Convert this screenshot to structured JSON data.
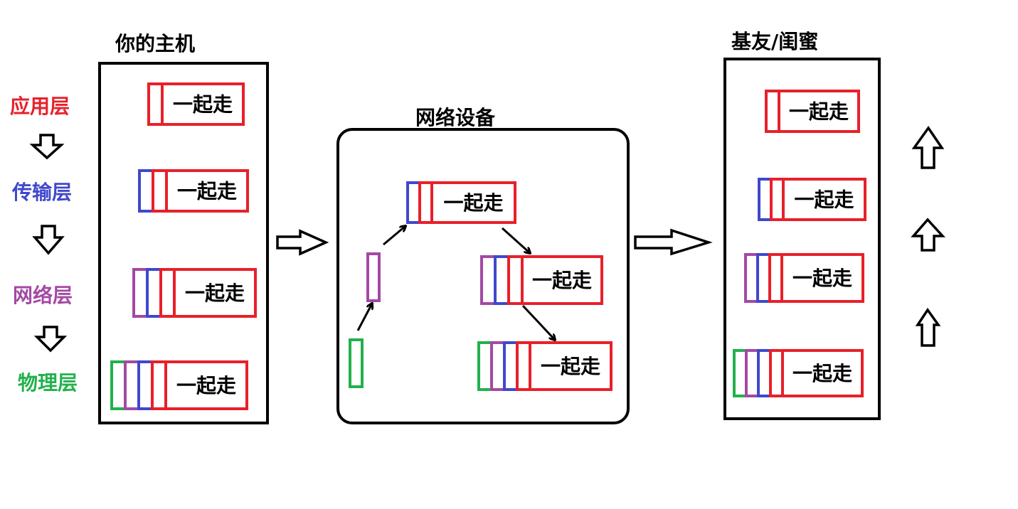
{
  "titles": {
    "host": "你的主机",
    "network_device": "网络设备",
    "friend": "基友/闺蜜"
  },
  "layers": [
    {
      "label": "应用层",
      "color": "#e8202a"
    },
    {
      "label": "传输层",
      "color": "#3f48cc"
    },
    {
      "label": "网络层",
      "color": "#a349a4"
    },
    {
      "label": "物理层",
      "color": "#22b14c"
    }
  ],
  "payload_text": "一起走",
  "colors": {
    "application": "#e8202a",
    "transport": "#3f48cc",
    "network": "#a349a4",
    "physical": "#22b14c",
    "outline": "#000000"
  },
  "icons": {
    "down_arrow": "hollow-down-arrow",
    "right_arrow": "hollow-right-arrow",
    "up_arrow": "hollow-up-arrow",
    "flow_arrow": "thin-arrow"
  }
}
